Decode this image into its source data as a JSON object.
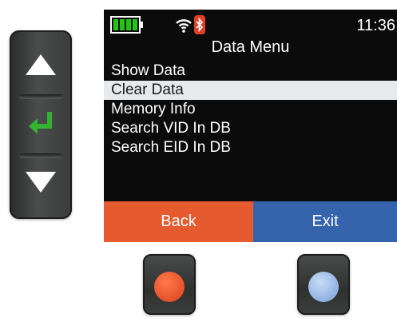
{
  "colors": {
    "battery": "#22c517",
    "back_key": "#e55a2f",
    "exit_key": "#3564ad",
    "bluetooth": "#e0402b",
    "selected_row": "#e7eaec",
    "left_button_dot": "#e4502a",
    "right_button_dot": "#8fb2e2"
  },
  "status": {
    "time": "11:36",
    "battery_icon": "battery-full-icon",
    "wifi_icon": "wifi-icon",
    "bluetooth_icon": "bluetooth-icon"
  },
  "menu": {
    "title": "Data Menu",
    "items": [
      {
        "label": "Show Data",
        "selected": false
      },
      {
        "label": "Clear Data",
        "selected": true
      },
      {
        "label": "Memory Info",
        "selected": false
      },
      {
        "label": "Search VID In DB",
        "selected": false
      },
      {
        "label": "Search EID In DB",
        "selected": false
      }
    ]
  },
  "softkeys": {
    "left_label": "Back",
    "right_label": "Exit"
  },
  "keypad": {
    "up_icon": "up-arrow-icon",
    "enter_icon": "enter-icon",
    "down_icon": "down-arrow-icon"
  }
}
